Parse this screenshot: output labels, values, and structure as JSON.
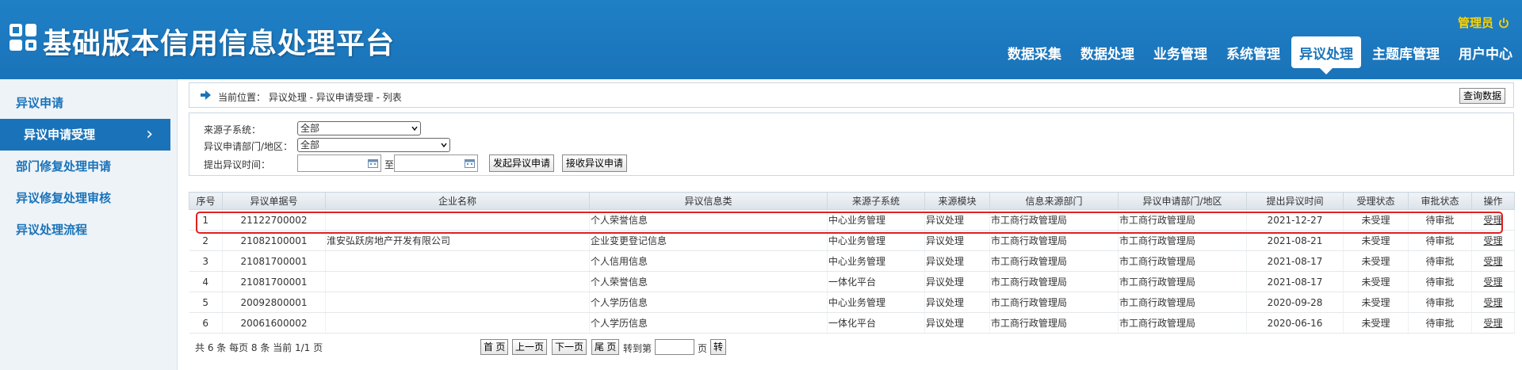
{
  "header": {
    "title": "基础版本信用信息处理平台",
    "user": "管理员",
    "nav": [
      "数据采集",
      "数据处理",
      "业务管理",
      "系统管理",
      "异议处理",
      "主题库管理",
      "用户中心"
    ],
    "active_nav": "异议处理"
  },
  "sidebar": {
    "items": [
      {
        "label": "异议申请"
      },
      {
        "label": "异议申请受理"
      },
      {
        "label": "部门修复处理申请"
      },
      {
        "label": "异议修复处理审核"
      },
      {
        "label": "异议处理流程"
      }
    ],
    "active": "异议申请受理"
  },
  "breadcrumb": {
    "text": "当前位置： 异议处理 - 异议申请受理 - 列表",
    "query_button": "查询数据"
  },
  "filters": {
    "source_label": "来源子系统：",
    "source_value": "全部",
    "dept_label": "异议申请部门/地区：",
    "dept_value": "全部",
    "time_label": "提出异议时间：",
    "to_label": "至",
    "btn_initiate": "发起异议申请",
    "btn_receive": "接收异议申请"
  },
  "table": {
    "headers": [
      "序号",
      "异议单据号",
      "企业名称",
      "异议信息类",
      "来源子系统",
      "来源模块",
      "信息来源部门",
      "异议申请部门/地区",
      "提出异议时间",
      "受理状态",
      "审批状态",
      "操作"
    ],
    "rows": [
      [
        "1",
        "21122700002",
        "",
        "个人荣誉信息",
        "中心业务管理",
        "异议处理",
        "市工商行政管理局",
        "市工商行政管理局",
        "2021-12-27",
        "未受理",
        "待审批",
        "受理"
      ],
      [
        "2",
        "21082100001",
        "淮安弘跃房地产开发有限公司",
        "企业变更登记信息",
        "中心业务管理",
        "异议处理",
        "市工商行政管理局",
        "市工商行政管理局",
        "2021-08-21",
        "未受理",
        "待审批",
        "受理"
      ],
      [
        "3",
        "21081700001",
        "",
        "个人信用信息",
        "中心业务管理",
        "异议处理",
        "市工商行政管理局",
        "市工商行政管理局",
        "2021-08-17",
        "未受理",
        "待审批",
        "受理"
      ],
      [
        "4",
        "21081700001",
        "",
        "个人荣誉信息",
        "一体化平台",
        "异议处理",
        "市工商行政管理局",
        "市工商行政管理局",
        "2021-08-17",
        "未受理",
        "待审批",
        "受理"
      ],
      [
        "5",
        "20092800001",
        "",
        "个人学历信息",
        "中心业务管理",
        "异议处理",
        "市工商行政管理局",
        "市工商行政管理局",
        "2020-09-28",
        "未受理",
        "待审批",
        "受理"
      ],
      [
        "6",
        "20061600002",
        "",
        "个人学历信息",
        "一体化平台",
        "异议处理",
        "市工商行政管理局",
        "市工商行政管理局",
        "2020-06-16",
        "未受理",
        "待审批",
        "受理"
      ]
    ]
  },
  "pager": {
    "info": "共 6 条  每页 8  条 当前 1/1 页",
    "first": "首 页",
    "prev": "上一页",
    "next": "下一页",
    "last": "尾 页",
    "goto_label": "转到第",
    "page_label": "页",
    "go": "转"
  },
  "colors": {
    "brand": "#1a73b9",
    "highlight": "#e02020",
    "user": "#ffd200"
  }
}
